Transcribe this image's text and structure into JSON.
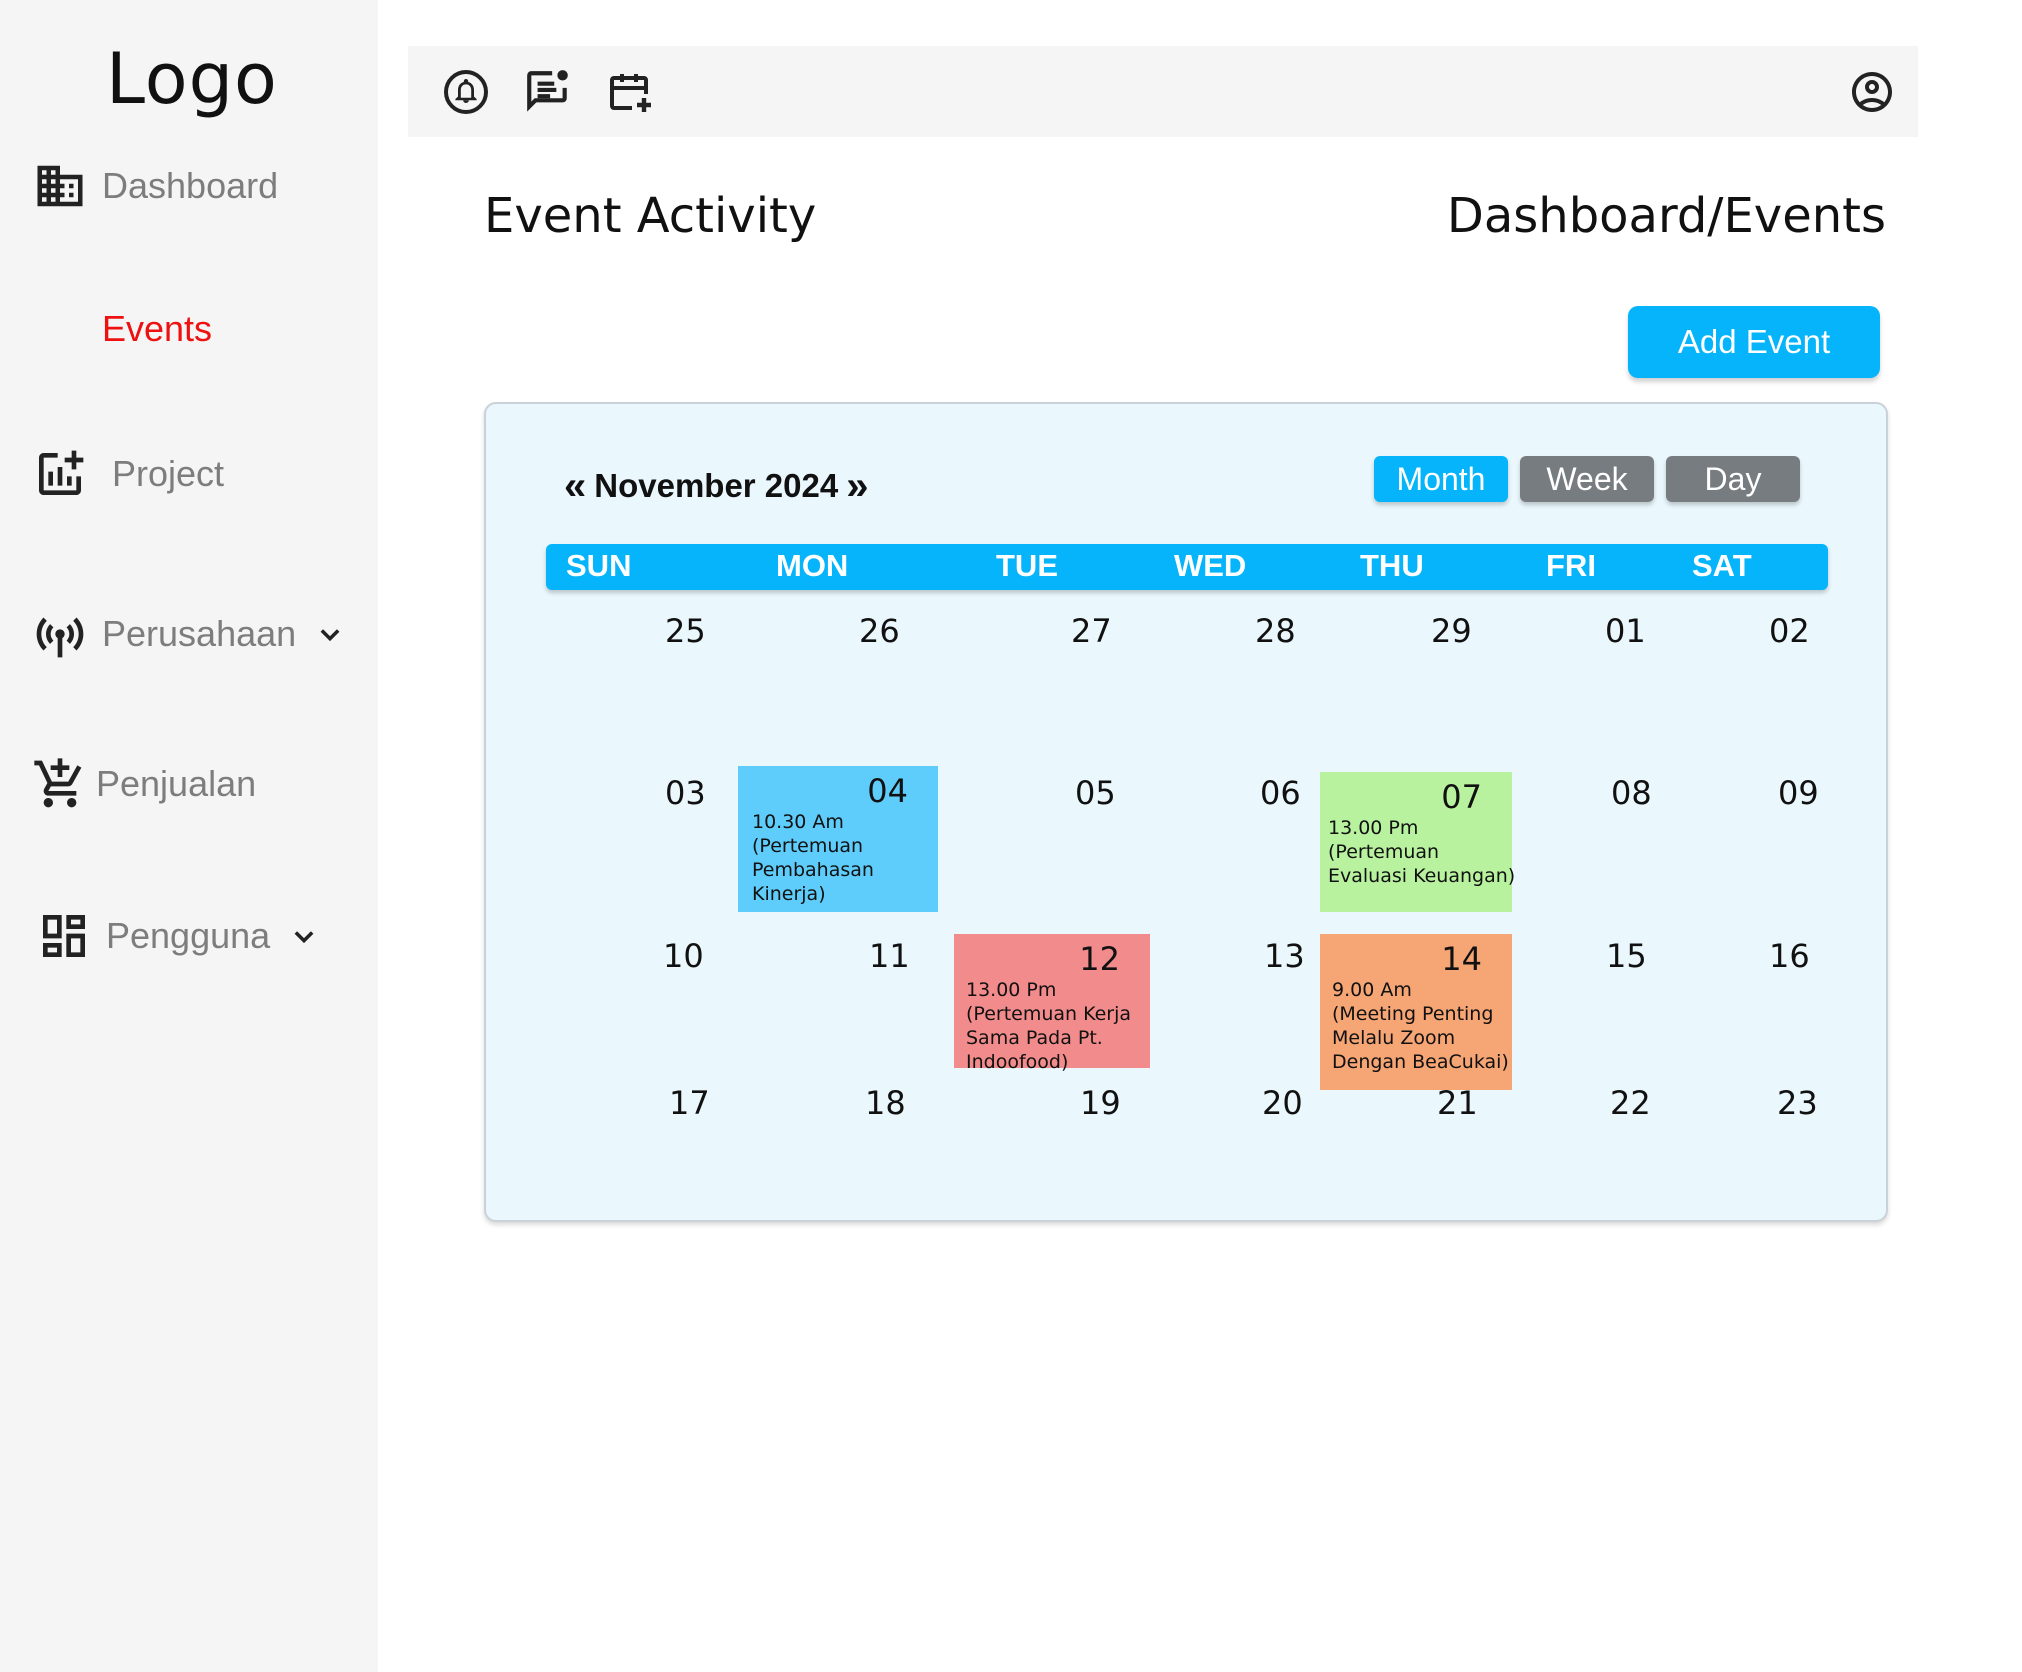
{
  "sidebar": {
    "logo": "Logo",
    "items": [
      {
        "label": "Dashboard",
        "icon": "building-icon"
      },
      {
        "label": "Events",
        "icon": "none"
      },
      {
        "label": "Project",
        "icon": "chart-add-icon"
      },
      {
        "label": "Perusahaan",
        "icon": "antenna-icon",
        "expandable": true
      },
      {
        "label": "Penjualan",
        "icon": "cart-add-icon"
      },
      {
        "label": "Pengguna",
        "icon": "dashboard-grid-icon",
        "expandable": true
      }
    ],
    "active_color": "#ee1111"
  },
  "topbar": {
    "icons": [
      "notification-bell-icon",
      "chat-notification-icon",
      "calendar-add-icon",
      "user-account-icon"
    ]
  },
  "header": {
    "title": "Event Activity",
    "breadcrumb": "Dashboard/Events",
    "add_button": "Add Event"
  },
  "calendar": {
    "prev": "«",
    "next": "»",
    "month_label": "November 2024",
    "views": [
      "Month",
      "Week",
      "Day"
    ],
    "active_view": "Month",
    "weekdays": [
      "SUN",
      "MON",
      "TUE",
      "WED",
      "THU",
      "FRI",
      "SAT"
    ],
    "weeks": [
      [
        "25",
        "26",
        "27",
        "28",
        "29",
        "01",
        "02"
      ],
      [
        "03",
        "04",
        "05",
        "06",
        "07",
        "08",
        "09"
      ],
      [
        "10",
        "11",
        "12",
        "13",
        "14",
        "15",
        "16"
      ],
      [
        "17",
        "18",
        "19",
        "20",
        "21",
        "22",
        "23"
      ]
    ],
    "events": [
      {
        "date": "04",
        "time": "10.30 Am",
        "title": "(Pertemuan Pembahasan Kinerja)",
        "color": "#5ecdfb"
      },
      {
        "date": "07",
        "time": "13.00 Pm",
        "title": "(Pertemuan Evaluasi Keuangan)",
        "color": "#b9f29f"
      },
      {
        "date": "12",
        "time": "13.00 Pm",
        "title": "(Pertemuan Kerja Sama Pada Pt. Indoofood)",
        "color": "#f28b8b"
      },
      {
        "date": "14",
        "time": "9.00 Am",
        "title": "(Meeting Penting Melalu Zoom Dengan BeaCukai)",
        "color": "#f6a574"
      }
    ],
    "accent_color": "#05b4fa",
    "inactive_view_color": "#777c80"
  }
}
